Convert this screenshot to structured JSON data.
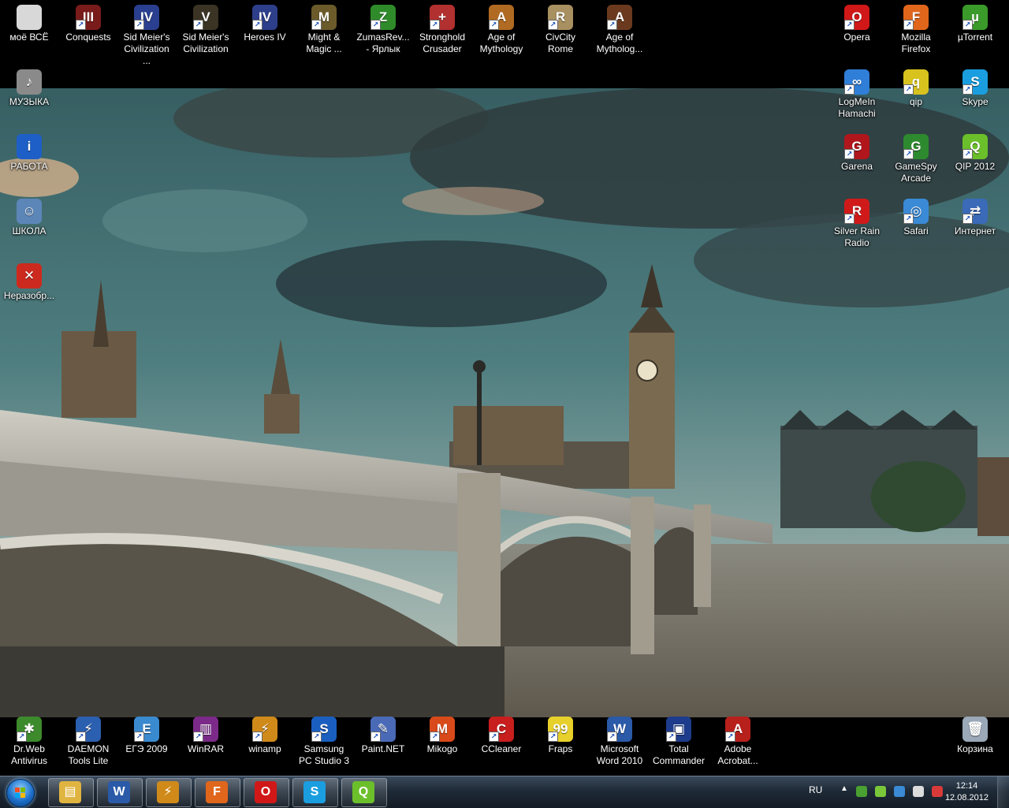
{
  "desktop": {
    "top_row": [
      {
        "label": "моё ВСЁ",
        "icon": "folder-icon",
        "color": "#d8d8d8",
        "glyph": ""
      },
      {
        "label": "Conquests",
        "icon": "civ3-conquests-icon",
        "color": "#7a1b1b",
        "glyph": "III"
      },
      {
        "label": "Sid Meier's Civilization ...",
        "icon": "civ4-flag-icon",
        "color": "#2a3f8f",
        "glyph": "IV"
      },
      {
        "label": "Sid Meier's Civilization",
        "icon": "civ5-icon",
        "color": "#3b3323",
        "glyph": "V"
      },
      {
        "label": "Heroes IV",
        "icon": "heroes-shield-icon",
        "color": "#2d3e8a",
        "glyph": "IV"
      },
      {
        "label": "Might & Magic ...",
        "icon": "dragon-icon",
        "color": "#6b5a2a",
        "glyph": "M"
      },
      {
        "label": "ZumasRev... - Ярлык",
        "icon": "frog-icon",
        "color": "#2f8b2a",
        "glyph": "Z"
      },
      {
        "label": "Stronghold Crusader",
        "icon": "crusader-shield-icon",
        "color": "#b23030",
        "glyph": "+"
      },
      {
        "label": "Age of Mythology",
        "icon": "aom-warrior-icon",
        "color": "#b06a22",
        "glyph": "A"
      },
      {
        "label": "CivCity Rome",
        "icon": "roman-temple-icon",
        "color": "#a89060",
        "glyph": "R"
      },
      {
        "label": "Age of Mytholog...",
        "icon": "aom-titans-icon",
        "color": "#6b3a1e",
        "glyph": "A"
      },
      {
        "label": "Opera",
        "icon": "opera-icon",
        "color": "#d01818",
        "glyph": "O"
      },
      {
        "label": "Mozilla Firefox",
        "icon": "firefox-icon",
        "color": "#e0661c",
        "glyph": "F"
      },
      {
        "label": "µTorrent",
        "icon": "utorrent-icon",
        "color": "#3a9a2a",
        "glyph": "µ"
      }
    ],
    "left_column": [
      {
        "label": "МУЗЫКА",
        "icon": "speaker-icon",
        "color": "#8a8a8a",
        "glyph": "♪"
      },
      {
        "label": "РАБОТА",
        "icon": "info-icon",
        "color": "#1d5fc7",
        "glyph": "i"
      },
      {
        "label": "ШКОЛА",
        "icon": "users-icon",
        "color": "#5c86b8",
        "glyph": "☺"
      },
      {
        "label": "Неразобр...",
        "icon": "red-x-icon",
        "color": "#cc2a1e",
        "glyph": "✕"
      }
    ],
    "right_grid": [
      {
        "label": "LogMeIn Hamachi",
        "icon": "hamachi-icon",
        "color": "#2f7ed8",
        "glyph": "∞"
      },
      {
        "label": "qip",
        "icon": "qip-icon",
        "color": "#d8c21e",
        "glyph": "q"
      },
      {
        "label": "Skype",
        "icon": "skype-icon",
        "color": "#1a9ee0",
        "glyph": "S"
      },
      {
        "label": "Garena",
        "icon": "garena-icon",
        "color": "#b0161c",
        "glyph": "G"
      },
      {
        "label": "GameSpy Arcade",
        "icon": "gamespy-icon",
        "color": "#2e8a2e",
        "glyph": "G"
      },
      {
        "label": "QIP 2012",
        "icon": "qip2012-icon",
        "color": "#6bbf2a",
        "glyph": "Q"
      },
      {
        "label": "Silver Rain Radio",
        "icon": "radio-icon",
        "color": "#d01a1a",
        "glyph": "R"
      },
      {
        "label": "Safari",
        "icon": "safari-compass-icon",
        "color": "#3a8ad6",
        "glyph": "◎"
      },
      {
        "label": "Интернет",
        "icon": "network-icon",
        "color": "#3a6ab8",
        "glyph": "⇄"
      }
    ],
    "bottom_row": [
      {
        "label": "Dr.Web Antivirus",
        "icon": "drweb-spider-icon",
        "color": "#3c8a2c",
        "glyph": "✱"
      },
      {
        "label": "DAEMON Tools Lite",
        "icon": "daemon-tools-icon",
        "color": "#2b5fb0",
        "glyph": "⚡"
      },
      {
        "label": "ЕГЭ 2009",
        "icon": "ege-book-icon",
        "color": "#3a8ad0",
        "glyph": "Е"
      },
      {
        "label": "WinRAR",
        "icon": "winrar-icon",
        "color": "#7b2a8a",
        "glyph": "▥"
      },
      {
        "label": "winamp",
        "icon": "winamp-icon",
        "color": "#d08a1a",
        "glyph": "⚡"
      },
      {
        "label": "Samsung PC Studio 3",
        "icon": "samsung-studio-icon",
        "color": "#1a5fc0",
        "glyph": "S"
      },
      {
        "label": "Paint.NET",
        "icon": "paintnet-icon",
        "color": "#4a6ab8",
        "glyph": "✎"
      },
      {
        "label": "Mikogo",
        "icon": "mikogo-icon",
        "color": "#d84a1a",
        "glyph": "M"
      },
      {
        "label": "CCleaner",
        "icon": "ccleaner-icon",
        "color": "#c81e1e",
        "glyph": "C"
      },
      {
        "label": "Fraps",
        "icon": "fraps-icon",
        "color": "#e8d02a",
        "glyph": "99"
      },
      {
        "label": "Microsoft Word 2010",
        "icon": "word-icon",
        "color": "#2a5aa8",
        "glyph": "W"
      },
      {
        "label": "Total Commander",
        "icon": "floppy-icon",
        "color": "#1e3c8c",
        "glyph": "▣"
      },
      {
        "label": "Adobe Acrobat...",
        "icon": "acrobat-icon",
        "color": "#b8201c",
        "glyph": "A"
      },
      {
        "label": "Корзина",
        "icon": "recycle-bin-icon",
        "color": "#9aa8b8",
        "glyph": "🗑"
      }
    ]
  },
  "taskbar": {
    "pinned": [
      {
        "name": "explorer-taskbar-button",
        "icon": "folders-icon",
        "color": "#e0b440",
        "glyph": "▤"
      },
      {
        "name": "word-taskbar-button",
        "icon": "word-icon",
        "color": "#2a5aa8",
        "glyph": "W"
      },
      {
        "name": "winamp-taskbar-button",
        "icon": "winamp-icon",
        "color": "#d08a1a",
        "glyph": "⚡"
      },
      {
        "name": "firefox-taskbar-button",
        "icon": "firefox-icon",
        "color": "#e0661c",
        "glyph": "F"
      },
      {
        "name": "opera-taskbar-button",
        "icon": "opera-icon",
        "color": "#d01818",
        "glyph": "O"
      },
      {
        "name": "skype-taskbar-button",
        "icon": "skype-icon",
        "color": "#1a9ee0",
        "glyph": "S"
      },
      {
        "name": "qip-taskbar-button",
        "icon": "qip2012-icon",
        "color": "#6bbf2a",
        "glyph": "Q"
      }
    ],
    "tray": {
      "language": "RU",
      "expand": "▲",
      "time": "12:14",
      "date": "12.08.2012",
      "icons": [
        {
          "name": "drweb-tray-icon",
          "color": "#4aa030"
        },
        {
          "name": "qip-tray-icon",
          "color": "#7ac83a"
        },
        {
          "name": "network-tray-icon",
          "color": "#3a8ad6"
        },
        {
          "name": "action-center-icon",
          "color": "#dcdcdc"
        },
        {
          "name": "volume-tray-icon",
          "color": "#d83a3a"
        }
      ]
    }
  },
  "colors": {
    "sky": "#3e6a70",
    "river": "#6b6558",
    "bridge": "#b7b6ad"
  }
}
